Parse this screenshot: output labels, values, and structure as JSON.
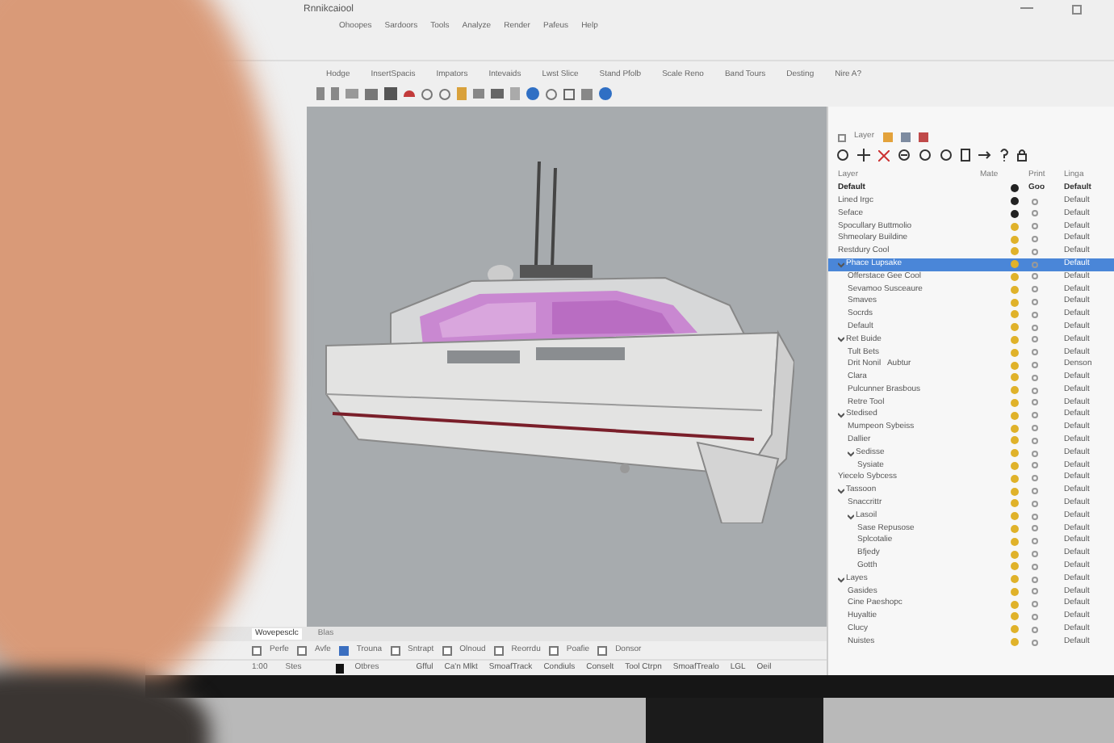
{
  "window": {
    "title": "Rnnikcaiool"
  },
  "menu": [
    "Ohoopes",
    "Sardoors",
    "Tools",
    "Analyze",
    "Render",
    "Pafeus",
    "Help"
  ],
  "toolbar_tabs": [
    "Hodge",
    "InsertSpacis",
    "Impators",
    "Intevaids",
    "Lwst Slice",
    "Stand Pfolb",
    "Scale Reno",
    "Band Tours",
    "Desting",
    "Nire A?"
  ],
  "layers": {
    "title": "Layer",
    "columns": [
      "Layer",
      "Mate",
      "Print",
      "Linga"
    ],
    "rows": [
      {
        "name": "Default",
        "current": true,
        "selected": false,
        "color": "#222222",
        "print": "Goo",
        "linetype": "Default"
      },
      {
        "name": "Lined Irgc",
        "current": false,
        "selected": false,
        "color": "#222222",
        "linetype": "Default"
      },
      {
        "name": "Seface",
        "current": false,
        "selected": false,
        "color": "#222222",
        "linetype": "Default"
      },
      {
        "name": "Spocullary Buttmolio",
        "current": false,
        "selected": false,
        "color": "#e0b22a",
        "linetype": "Default"
      },
      {
        "name": "Shmeolary Buildine",
        "current": false,
        "selected": false,
        "color": "#e0b22a",
        "linetype": "Default"
      },
      {
        "name": "Restdury Cool",
        "current": false,
        "selected": false,
        "color": "#e0b22a",
        "linetype": "Default"
      },
      {
        "name": "Phace Lupsake",
        "current": false,
        "selected": true,
        "color": "#e0b22a",
        "linetype": "Default",
        "expanded": true,
        "children": [
          {
            "name": "Offerstace Gee Cool",
            "current": false,
            "selected": false,
            "color": "#e0b22a",
            "linetype": "Default"
          },
          {
            "name": "Sevamoo Susceaure",
            "current": false,
            "selected": false,
            "color": "#e0b22a",
            "linetype": "Default"
          },
          {
            "name": "Smaves",
            "current": false,
            "selected": false,
            "color": "#e0b22a",
            "linetype": "Default"
          },
          {
            "name": "Socrds",
            "current": false,
            "selected": false,
            "color": "#e0b22a",
            "linetype": "Default"
          },
          {
            "name": "Default",
            "current": false,
            "selected": false,
            "color": "#e0b22a",
            "linetype": "Default"
          }
        ]
      },
      {
        "name": "Ret Buide",
        "current": false,
        "selected": false,
        "color": "#e0b22a",
        "linetype": "Default",
        "expanded": true,
        "children": [
          {
            "name": "Tult Bets",
            "current": false,
            "selected": false,
            "color": "#e0b22a",
            "linetype": "Default"
          },
          {
            "name": "Drit Nonil   Aubtur",
            "current": false,
            "selected": false,
            "color": "#e0b22a",
            "linetype": "Denson"
          },
          {
            "name": "Clara",
            "current": false,
            "selected": false,
            "color": "#e0b22a",
            "linetype": "Default"
          },
          {
            "name": "Pulcunner Brasbous",
            "current": false,
            "selected": false,
            "color": "#e0b22a",
            "linetype": "Default"
          },
          {
            "name": "Retre Tool",
            "current": false,
            "selected": false,
            "color": "#e0b22a",
            "linetype": "Default"
          }
        ]
      },
      {
        "name": "Stedised",
        "current": false,
        "selected": false,
        "color": "#e0b22a",
        "linetype": "Default",
        "expanded": true,
        "children": [
          {
            "name": "Mumpeon Sybeiss",
            "current": false,
            "selected": false,
            "color": "#e0b22a",
            "linetype": "Default"
          },
          {
            "name": "Dallier",
            "current": false,
            "selected": false,
            "color": "#e0b22a",
            "linetype": "Default"
          },
          {
            "name": "Sedisse",
            "current": false,
            "selected": false,
            "color": "#e0b22a",
            "linetype": "Default",
            "expanded": true,
            "children": [
              {
                "name": "Sysiate",
                "current": false,
                "selected": false,
                "color": "#e0b22a",
                "linetype": "Default"
              }
            ]
          }
        ]
      },
      {
        "name": "Yiecelo Sybcess",
        "current": false,
        "selected": false,
        "color": "#e0b22a",
        "linetype": "Default"
      },
      {
        "name": "Tassoon",
        "current": false,
        "selected": false,
        "color": "#e0b22a",
        "linetype": "Default",
        "expanded": true,
        "children": [
          {
            "name": "Snaccrittr",
            "current": false,
            "selected": false,
            "color": "#e0b22a",
            "linetype": "Default"
          },
          {
            "name": "Lasoil",
            "current": false,
            "selected": false,
            "color": "#e0b22a",
            "linetype": "Default",
            "expanded": true,
            "children": [
              {
                "name": "Sase Repusose",
                "current": false,
                "selected": false,
                "color": "#e0b22a",
                "linetype": "Default"
              },
              {
                "name": "Splcotalie",
                "current": false,
                "selected": false,
                "color": "#e0b22a",
                "linetype": "Default"
              },
              {
                "name": "Bfjedy",
                "current": false,
                "selected": false,
                "color": "#e0b22a",
                "linetype": "Default"
              },
              {
                "name": "Gotth",
                "current": false,
                "selected": false,
                "color": "#e0b22a",
                "linetype": "Default"
              }
            ]
          }
        ]
      },
      {
        "name": "Layes",
        "current": false,
        "selected": false,
        "color": "#e0b22a",
        "linetype": "Default",
        "expanded": true,
        "children": [
          {
            "name": "Gasides",
            "current": false,
            "selected": false,
            "color": "#e0b22a",
            "linetype": "Default"
          },
          {
            "name": "Cine Paeshopc",
            "current": false,
            "selected": false,
            "color": "#e0b22a",
            "linetype": "Default"
          },
          {
            "name": "Huyaltie",
            "current": false,
            "selected": false,
            "color": "#e0b22a",
            "linetype": "Default"
          },
          {
            "name": "Clucy",
            "current": false,
            "selected": false,
            "color": "#e0b22a",
            "linetype": "Default"
          },
          {
            "name": "Nuistes",
            "current": false,
            "selected": false,
            "color": "#e0b22a",
            "linetype": "Default"
          }
        ]
      }
    ]
  },
  "viewport_tabs": [
    {
      "label": "Wovepesclc",
      "selected": true
    },
    {
      "label": "Blas",
      "selected": false
    }
  ],
  "osnaps": [
    {
      "label": "Perfe",
      "checked": false
    },
    {
      "label": "Avfe",
      "checked": false
    },
    {
      "label": "Trouna",
      "checked": true
    },
    {
      "label": "Sntrapt",
      "checked": false
    },
    {
      "label": "Olnoud",
      "checked": false
    },
    {
      "label": "Reorrdu",
      "checked": false
    },
    {
      "label": "Poafie",
      "checked": false
    },
    {
      "label": "Donsor",
      "checked": false
    }
  ],
  "status_bar": {
    "left": [
      "1:00",
      "Stes"
    ],
    "layer": "Otbres",
    "items": [
      "Gfful",
      "Ca'n Mlkt",
      "SmoafTrack",
      "Condiuls",
      "Conselt",
      "Tool Ctrpn",
      "SmoafTrealo",
      "LGL",
      "Oeil"
    ]
  }
}
